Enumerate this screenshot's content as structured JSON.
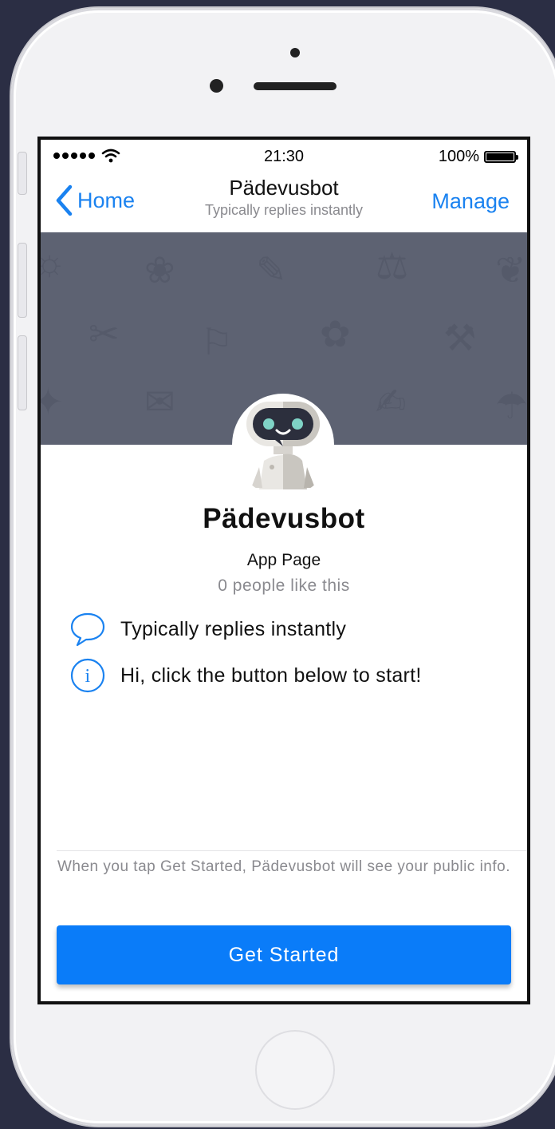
{
  "status_bar": {
    "time": "21:30",
    "battery": "100%"
  },
  "nav": {
    "back_label": "Home",
    "title": "Pädevusbot",
    "subtitle": "Typically replies instantly",
    "manage_label": "Manage"
  },
  "profile": {
    "name": "Pädevusbot",
    "page_type": "App Page",
    "likes": "0 people like this"
  },
  "info": [
    {
      "icon": "chat-bubble-icon",
      "text": "Typically replies instantly"
    },
    {
      "icon": "info-icon",
      "text": "Hi, click the button below to start!"
    }
  ],
  "footer": {
    "notice": "When you tap Get Started, Pädevusbot will see your public info.",
    "cta_label": "Get Started"
  },
  "colors": {
    "accent": "#1a82f0",
    "button": "#0a7cf9",
    "banner": "#5d6272"
  }
}
